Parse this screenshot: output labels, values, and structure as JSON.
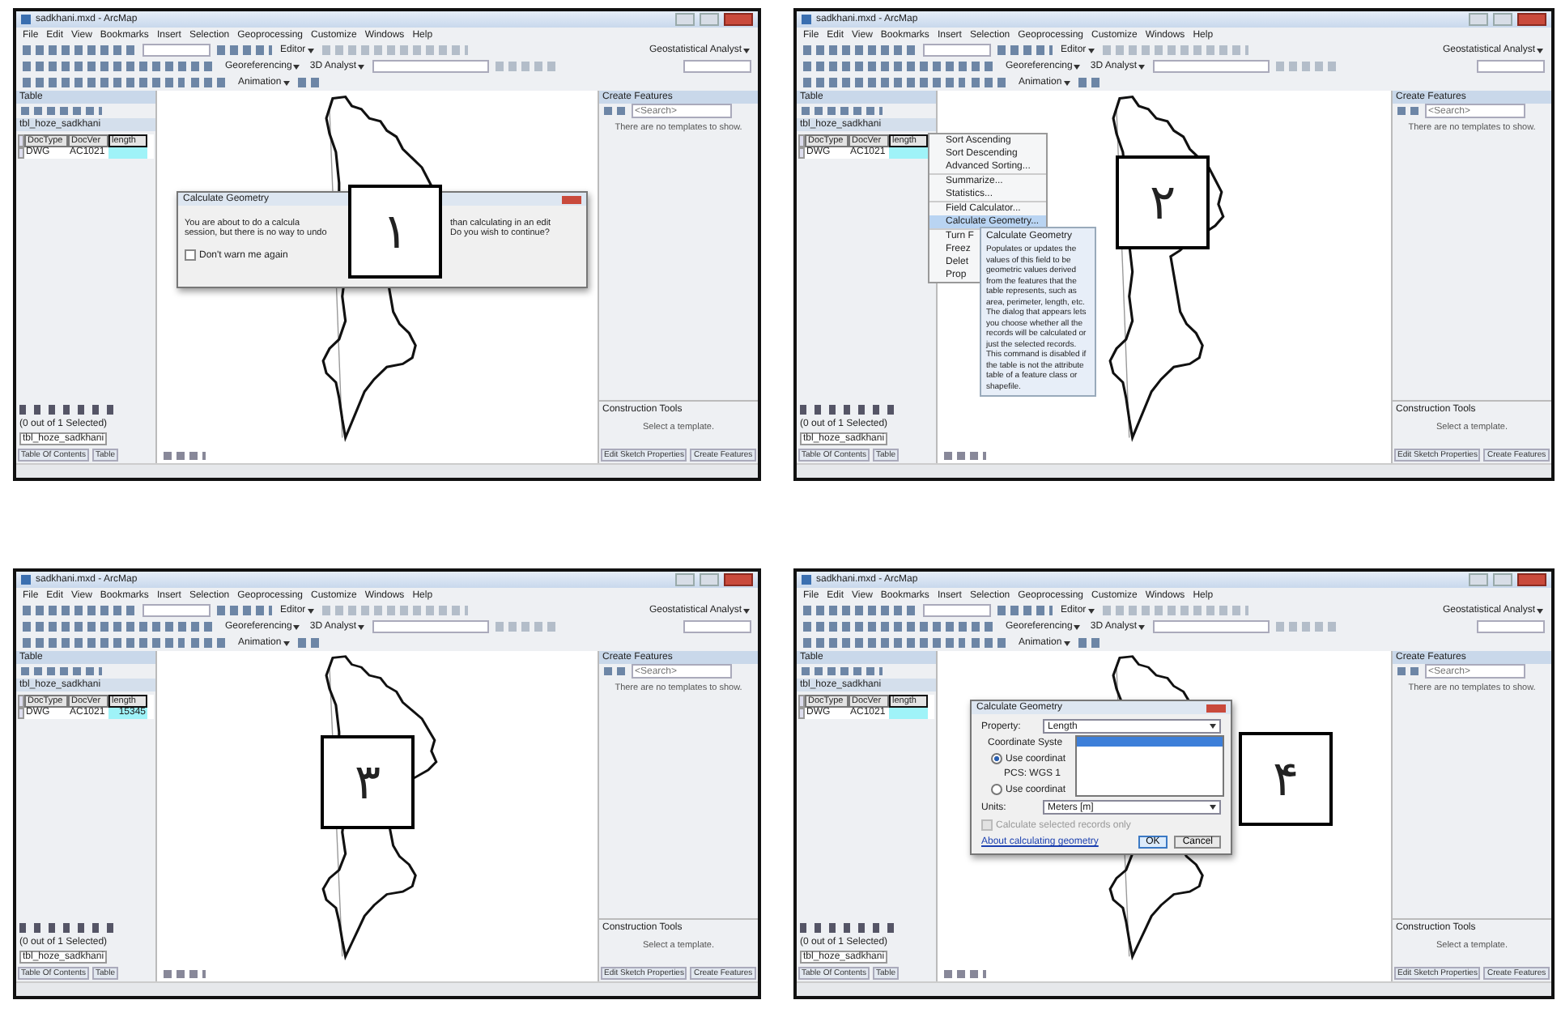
{
  "panels": [
    {
      "title": "sadkhani.mxd - ArcMap",
      "menu": [
        "File",
        "Edit",
        "View",
        "Bookmarks",
        "Insert",
        "Selection",
        "Geoprocessing",
        "Customize",
        "Windows",
        "Help"
      ],
      "editor_menu": "Editor",
      "geostat_menu": "Geostatistical Analyst",
      "georef_menu": "Georeferencing",
      "analyst_menu": "3D Analyst",
      "animation_menu": "Animation",
      "table_title": "Table",
      "table_tab": "tbl_hoze_sadkhani",
      "columns": [
        {
          "label": "DocType",
          "selected": false
        },
        {
          "label": "DocVer",
          "selected": false
        },
        {
          "label": "length",
          "selected": true
        }
      ],
      "row": [
        "DWG",
        "AC1021"
      ],
      "selection_status": "(0 out of 1 Selected)",
      "bottom_tab": "tbl_hoze_sadkhani",
      "toc_tab": "Table Of Contents",
      "table_button": "Table",
      "right_title": "Create Features",
      "search_placeholder": "<Search>",
      "no_templates": "There are no templates to show.",
      "construction_title": "Construction Tools",
      "select_template": "Select a template.",
      "sketch_button": "Edit Sketch Properties",
      "create_button": "Create Features",
      "step_number": "۱",
      "overlay": {
        "kind": "warning_dialog",
        "title": "Calculate Geometry",
        "left_lines": [
          "You are about to do a calcula",
          "session, but there is no way to undo"
        ],
        "right_lines": [
          "than calculating in an edit",
          "Do you wish to continue?"
        ],
        "checkbox": {
          "label": "Don't warn me again",
          "checked": false
        }
      }
    },
    {
      "title": "sadkhani.mxd - ArcMap",
      "menu": [
        "File",
        "Edit",
        "View",
        "Bookmarks",
        "Insert",
        "Selection",
        "Geoprocessing",
        "Customize",
        "Windows",
        "Help"
      ],
      "editor_menu": "Editor",
      "geostat_menu": "Geostatistical Analyst",
      "georef_menu": "Georeferencing",
      "analyst_menu": "3D Analyst",
      "animation_menu": "Animation",
      "table_title": "Table",
      "table_tab": "tbl_hoze_sadkhani",
      "columns": [
        {
          "label": "DocType",
          "selected": false
        },
        {
          "label": "DocVer",
          "selected": false
        },
        {
          "label": "length",
          "selected": true
        }
      ],
      "row": [
        "DWG",
        "AC1021"
      ],
      "selection_status": "(0 out of 1 Selected)",
      "bottom_tab": "tbl_hoze_sadkhani",
      "toc_tab": "Table Of Contents",
      "table_button": "Table",
      "right_title": "Create Features",
      "search_placeholder": "<Search>",
      "no_templates": "There are no templates to show.",
      "construction_title": "Construction Tools",
      "select_template": "Select a template.",
      "sketch_button": "Edit Sketch Properties",
      "create_button": "Create Features",
      "step_number": "۲",
      "overlay": {
        "kind": "context_menu",
        "items": [
          {
            "label": "Sort Ascending",
            "selected": false,
            "group_start": false
          },
          {
            "label": "Sort Descending",
            "selected": false,
            "group_start": false
          },
          {
            "label": "Advanced Sorting...",
            "selected": false,
            "group_start": false
          },
          {
            "label": "Summarize...",
            "selected": false,
            "group_start": true
          },
          {
            "label": "Statistics...",
            "selected": false,
            "group_start": false
          },
          {
            "label": "Field Calculator...",
            "selected": false,
            "group_start": true
          },
          {
            "label": "Calculate Geometry...",
            "selected": true,
            "group_start": false
          },
          {
            "label": "Turn F",
            "selected": false,
            "group_start": true
          },
          {
            "label": "Freez",
            "selected": false,
            "group_start": false
          },
          {
            "label": "Delet",
            "selected": false,
            "group_start": false
          },
          {
            "label": "Prop",
            "selected": false,
            "group_start": false
          }
        ],
        "tooltip": {
          "title": "Calculate Geometry",
          "text": "Populates or updates the values of this field to be geometric values derived from the features that the table represents, such as area, perimeter, length, etc. The dialog that appears lets you choose whether all the records will be calculated or just the selected records. This command is disabled if the table is not the attribute table of a feature class or shapefile."
        }
      }
    },
    {
      "title": "sadkhani.mxd - ArcMap",
      "menu": [
        "File",
        "Edit",
        "View",
        "Bookmarks",
        "Insert",
        "Selection",
        "Geoprocessing",
        "Customize",
        "Windows",
        "Help"
      ],
      "editor_menu": "Editor",
      "geostat_menu": "Geostatistical Analyst",
      "georef_menu": "Georeferencing",
      "analyst_menu": "3D Analyst",
      "animation_menu": "Animation",
      "table_title": "Table",
      "table_tab": "tbl_hoze_sadkhani",
      "columns": [
        {
          "label": "DocType",
          "selected": false
        },
        {
          "label": "DocVer",
          "selected": false
        },
        {
          "label": "length",
          "selected": true
        }
      ],
      "row": [
        "DWG",
        "AC1021",
        "15345"
      ],
      "selection_status": "(0 out of 1 Selected)",
      "bottom_tab": "tbl_hoze_sadkhani",
      "toc_tab": "Table Of Contents",
      "table_button": "Table",
      "right_title": "Create Features",
      "search_placeholder": "<Search>",
      "no_templates": "There are no templates to show.",
      "construction_title": "Construction Tools",
      "select_template": "Select a template.",
      "sketch_button": "Edit Sketch Properties",
      "create_button": "Create Features",
      "step_number": "۳"
    },
    {
      "title": "sadkhani.mxd - ArcMap",
      "menu": [
        "File",
        "Edit",
        "View",
        "Bookmarks",
        "Insert",
        "Selection",
        "Geoprocessing",
        "Customize",
        "Windows",
        "Help"
      ],
      "editor_menu": "Editor",
      "geostat_menu": "Geostatistical Analyst",
      "georef_menu": "Georeferencing",
      "analyst_menu": "3D Analyst",
      "animation_menu": "Animation",
      "table_title": "Table",
      "table_tab": "tbl_hoze_sadkhani",
      "columns": [
        {
          "label": "DocType",
          "selected": false
        },
        {
          "label": "DocVer",
          "selected": false
        },
        {
          "label": "length",
          "selected": true
        }
      ],
      "row": [
        "DWG",
        "AC1021"
      ],
      "selection_status": "(0 out of 1 Selected)",
      "bottom_tab": "tbl_hoze_sadkhani",
      "toc_tab": "Table Of Contents",
      "table_button": "Table",
      "right_title": "Create Features",
      "search_placeholder": "<Search>",
      "no_templates": "There are no templates to show.",
      "construction_title": "Construction Tools",
      "select_template": "Select a template.",
      "sketch_button": "Edit Sketch Properties",
      "create_button": "Create Features",
      "step_number": "۴",
      "overlay": {
        "kind": "geometry_dialog",
        "title": "Calculate Geometry",
        "property_label": "Property:",
        "property_value": "Length",
        "coord_label": "Coordinate Syste",
        "radios": [
          {
            "label": "Use coordinat",
            "selected": true
          },
          {
            "label": "Use coordinat",
            "selected": false
          }
        ],
        "pcs": "PCS: WGS 1",
        "units_label": "Units:",
        "units_value": "Meters [m]",
        "checkbox": {
          "label": "Calculate selected records only",
          "checked": false,
          "disabled": true
        },
        "link": "About calculating geometry",
        "ok": "OK",
        "cancel": "Cancel"
      }
    }
  ]
}
